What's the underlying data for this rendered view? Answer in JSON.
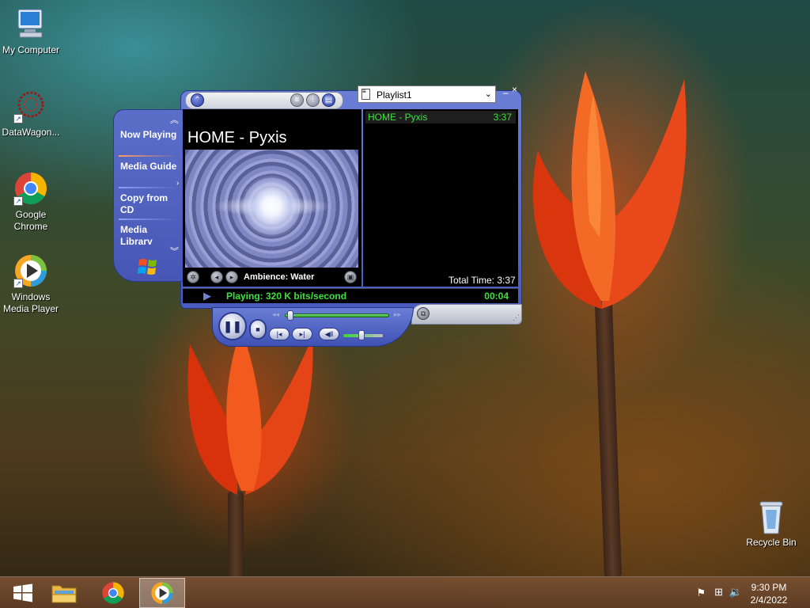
{
  "desktop": {
    "icons": [
      {
        "label": "My Computer"
      },
      {
        "label": "DataWagon..."
      },
      {
        "label": "Google Chrome"
      },
      {
        "label": "Windows Media Player"
      },
      {
        "label": "Recycle Bin"
      }
    ]
  },
  "wmp": {
    "taskpane": {
      "items": [
        {
          "label": "Now Playing"
        },
        {
          "label": "Media Guide"
        },
        {
          "label": "Copy from CD"
        },
        {
          "label": "Media Library"
        }
      ]
    },
    "now_playing_title": "HOME - Pyxis",
    "visualization_name": "Ambience: Water",
    "playlist_selector": "Playlist1",
    "playlist": [
      {
        "title": "HOME - Pyxis",
        "duration": "3:37"
      }
    ],
    "total_time": "Total Time: 3:37",
    "status_text": "Playing: 320 K bits/second",
    "elapsed": "00:04",
    "seek_fraction": 0.02,
    "volume_fraction": 0.45,
    "colors": {
      "skin_blue": "#4a5cc0",
      "status_green": "#3ee03e"
    }
  },
  "taskbar": {
    "clock_time": "9:30 PM",
    "clock_date": "2/4/2022"
  }
}
